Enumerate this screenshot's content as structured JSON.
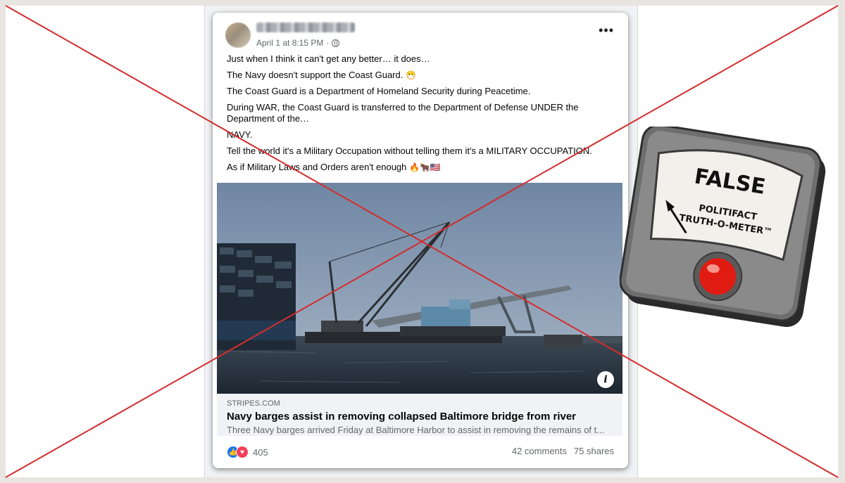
{
  "post": {
    "timestamp": "April 1 at 8:15 PM",
    "more_label": "•••",
    "paragraphs": {
      "p1": "Just when I think it can't get any better… it does…",
      "p2": "The Navy doesn't support the Coast Guard.",
      "p2_emoji": "😷",
      "p3": "The Coast Guard is a Department of Homeland Security during Peacetime.",
      "p4": "During WAR, the Coast Guard is transferred to the Department of Defense UNDER the Department of the…",
      "p5": "NAVY.",
      "p6": "Tell the world it's a Military Occupation without telling them it's a MILITARY OCCUPATION.",
      "p7": "As if Military Laws and Orders aren't enough",
      "p7_emoji": "🔥🐂🇺🇸"
    }
  },
  "link_preview": {
    "info_label": "i",
    "domain": "STRIPES.COM",
    "title": "Navy barges assist in removing collapsed Baltimore bridge from river",
    "description": "Three Navy barges arrived Friday at Baltimore Harbor to assist in removing the remains of t..."
  },
  "engagement": {
    "reaction_count": "405",
    "comments": "42 comments",
    "shares": "75 shares"
  },
  "rating": {
    "verdict": "FALSE",
    "line1": "POLITIFACT",
    "line2": "TRUTH-O-METER™"
  },
  "colors": {
    "cross_line": "#d42c2c",
    "like": "#1877f2",
    "love": "#f33e58",
    "meter_bulb": "#e01b12"
  }
}
